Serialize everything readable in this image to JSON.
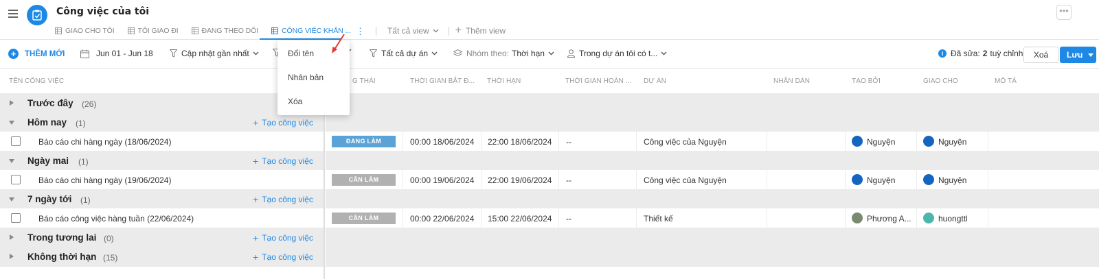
{
  "header": {
    "title": "Công việc của tôi",
    "tabs": [
      {
        "label": "GIAO CHO TÔI",
        "active": false
      },
      {
        "label": "TÔI GIAO ĐI",
        "active": false
      },
      {
        "label": "ĐANG THEO DÕI",
        "active": false
      },
      {
        "label": "CÔNG VIỆC KHẨN ...",
        "active": true
      }
    ],
    "all_views": "Tất cả view",
    "add_view": "Thêm view",
    "more": "•••"
  },
  "dropdown": {
    "items": [
      "Đổi tên",
      "Nhân bản",
      "Xóa"
    ]
  },
  "toolbar": {
    "add_new": "THÊM MỚI",
    "date_range": "Jun 01 - Jun 18",
    "sort": "Cập nhật gần nhất",
    "all_projects": "Tất cả dự án",
    "group_by_prefix": "Nhóm theo:",
    "group_by_value": "Thời hạn",
    "scope": "Trong dự án tôi có t...",
    "edited_prefix": "Đã sửa:",
    "edited_count": "2",
    "edited_suffix": "tuỳ chỉnh",
    "delete": "Xoá",
    "save": "Lưu"
  },
  "columns": [
    "TÊN CÔNG VIỆC",
    "G THÁI",
    "THỜI GIAN BẮT Đ...",
    "THỜI HẠN",
    "THỜI GIAN HOÀN ...",
    "DỰ ÁN",
    "NHÃN DÁN",
    "TẠO BỞI",
    "GIAO CHO",
    "MÔ TẢ"
  ],
  "create_task": "Tạo công việc",
  "groups": [
    {
      "title": "Trước đây",
      "count": "(26)",
      "expanded": false,
      "tasks": []
    },
    {
      "title": "Hôm nay",
      "count": "(1)",
      "expanded": true,
      "tasks": [
        {
          "name": "Báo cáo chi hàng ngày (18/06/2024)",
          "status": "ĐANG LÀM",
          "start": "00:00 18/06/2024",
          "due": "22:00 18/06/2024",
          "done": "--",
          "project": "Công việc của Nguyện",
          "created_by": "Nguyện",
          "assignee": "Nguyện"
        }
      ]
    },
    {
      "title": "Ngày mai",
      "count": "(1)",
      "expanded": true,
      "tasks": [
        {
          "name": "Báo cáo chi hàng ngày (19/06/2024)",
          "status": "CẦN LÀM",
          "start": "00:00 19/06/2024",
          "due": "22:00 19/06/2024",
          "done": "--",
          "project": "Công việc của Nguyện",
          "created_by": "Nguyện",
          "assignee": "Nguyện"
        }
      ]
    },
    {
      "title": "7 ngày tới",
      "count": "(1)",
      "expanded": true,
      "tasks": [
        {
          "name": "Báo cáo công việc hàng tuần (22/06/2024)",
          "status": "CẦN LÀM",
          "start": "00:00 22/06/2024",
          "due": "15:00 22/06/2024",
          "done": "--",
          "project": "Thiết kế",
          "created_by": "Phương A...",
          "assignee": "huongttl"
        }
      ]
    },
    {
      "title": "Trong tương lai",
      "count": "(0)",
      "expanded": false,
      "tasks": []
    },
    {
      "title": "Không thời hạn",
      "count": "(15)",
      "expanded": false,
      "tasks": []
    }
  ],
  "colors": {
    "accent": "#1e88e5",
    "status_doing": "#5ba3d6",
    "status_todo": "#b1b1b1",
    "arrow": "#e53935"
  }
}
